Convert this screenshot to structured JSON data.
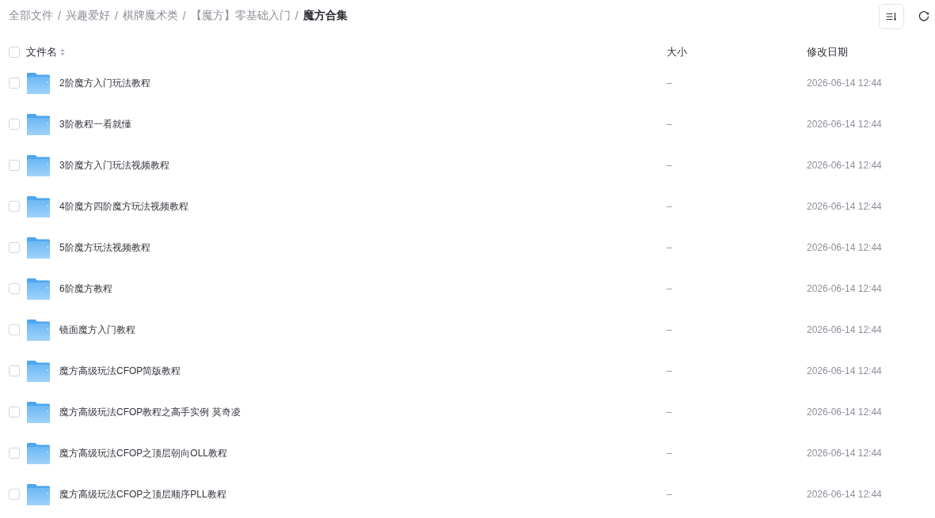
{
  "breadcrumb": {
    "separator": "/",
    "items": [
      {
        "label": "全部文件",
        "current": false
      },
      {
        "label": "兴趣爱好",
        "current": false
      },
      {
        "label": "棋牌魔术类",
        "current": false
      },
      {
        "label": "【魔方】零基础入门",
        "current": false
      },
      {
        "label": "魔方合集",
        "current": true
      }
    ]
  },
  "table": {
    "select_all": {
      "checked": false
    },
    "columns": [
      {
        "label": "文件名",
        "sortable": true
      },
      {
        "label": "大小",
        "sortable": false
      },
      {
        "label": "修改日期",
        "sortable": false
      }
    ],
    "rows": [
      {
        "name": "2阶魔方入门玩法教程",
        "size": "–",
        "modified": "2026-06-14 12:44",
        "checked": false
      },
      {
        "name": "3阶教程一看就懂",
        "size": "–",
        "modified": "2026-06-14 12:44",
        "checked": false
      },
      {
        "name": "3阶魔方入门玩法视频教程",
        "size": "–",
        "modified": "2026-06-14 12:44",
        "checked": false
      },
      {
        "name": "4阶魔方四阶魔方玩法视频教程",
        "size": "–",
        "modified": "2026-06-14 12:44",
        "checked": false
      },
      {
        "name": "5阶魔方玩法视频教程",
        "size": "–",
        "modified": "2026-06-14 12:44",
        "checked": false
      },
      {
        "name": "6阶魔方教程",
        "size": "–",
        "modified": "2026-06-14 12:44",
        "checked": false
      },
      {
        "name": "镜面魔方入门教程",
        "size": "–",
        "modified": "2026-06-14 12:44",
        "checked": false
      },
      {
        "name": "魔方高级玩法CFOP简版教程",
        "size": "–",
        "modified": "2026-06-14 12:44",
        "checked": false
      },
      {
        "name": "魔方高级玩法CFOP教程之高手实例 莫奇凌",
        "size": "–",
        "modified": "2026-06-14 12:44",
        "checked": false
      },
      {
        "name": "魔方高级玩法CFOP之顶层朝向OLL教程",
        "size": "–",
        "modified": "2026-06-14 12:44",
        "checked": false
      },
      {
        "name": "魔方高级玩法CFOP之顶层顺序PLL教程",
        "size": "–",
        "modified": "2026-06-14 12:44",
        "checked": false
      }
    ]
  }
}
